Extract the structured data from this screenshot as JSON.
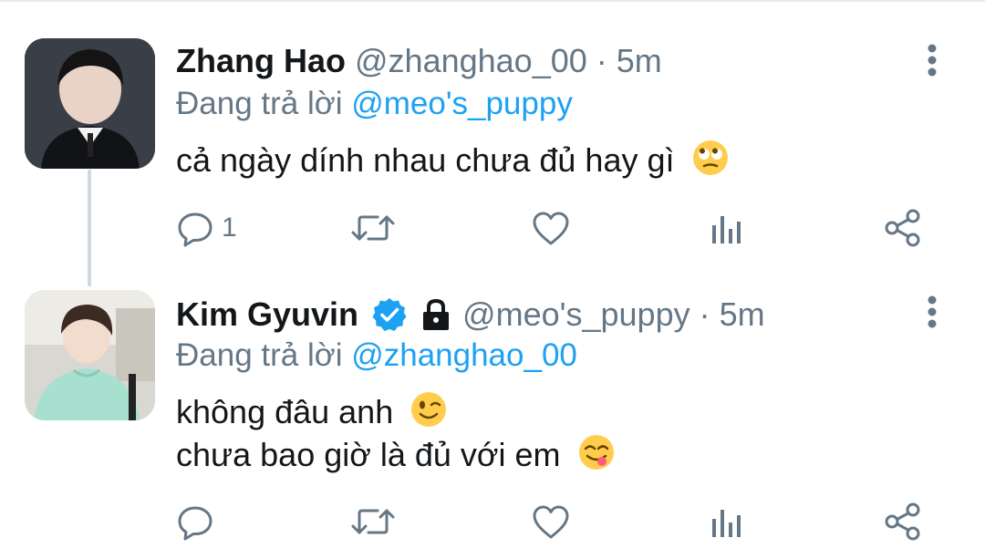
{
  "tweets": [
    {
      "name": "Zhang Hao",
      "handle": "@zhanghao_00",
      "separator": "·",
      "time": "5m",
      "verified": false,
      "protected": false,
      "replying_prefix": "Đang trả lời",
      "replying_to": "@meo's_puppy",
      "lines": [
        "cả ngày dính nhau chưa đủ hay gì"
      ],
      "emoji": [
        "face-with-rolling-eyes-emoji"
      ],
      "reply_count": "1"
    },
    {
      "name": "Kim Gyuvin",
      "handle": "@meo's_puppy",
      "separator": "·",
      "time": "5m",
      "verified": true,
      "protected": true,
      "replying_prefix": "Đang trả lời",
      "replying_to": "@zhanghao_00",
      "lines": [
        "không đâu anh",
        "chưa bao giờ là đủ với em"
      ],
      "emoji": [
        "winking-face-emoji",
        "face-savoring-food-emoji"
      ],
      "reply_count": ""
    }
  ],
  "icons": {
    "reply": "reply-icon",
    "retweet": "retweet-icon",
    "like": "heart-icon",
    "stats": "stats-icon",
    "share": "share-icon",
    "more": "more-vertical-icon",
    "verified": "verified-badge-icon",
    "lock": "lock-icon"
  },
  "colors": {
    "text": "#14171a",
    "secondary": "#657786",
    "link": "#1da1f2",
    "icon": "#657786",
    "thread_line": "#cfd9de"
  }
}
